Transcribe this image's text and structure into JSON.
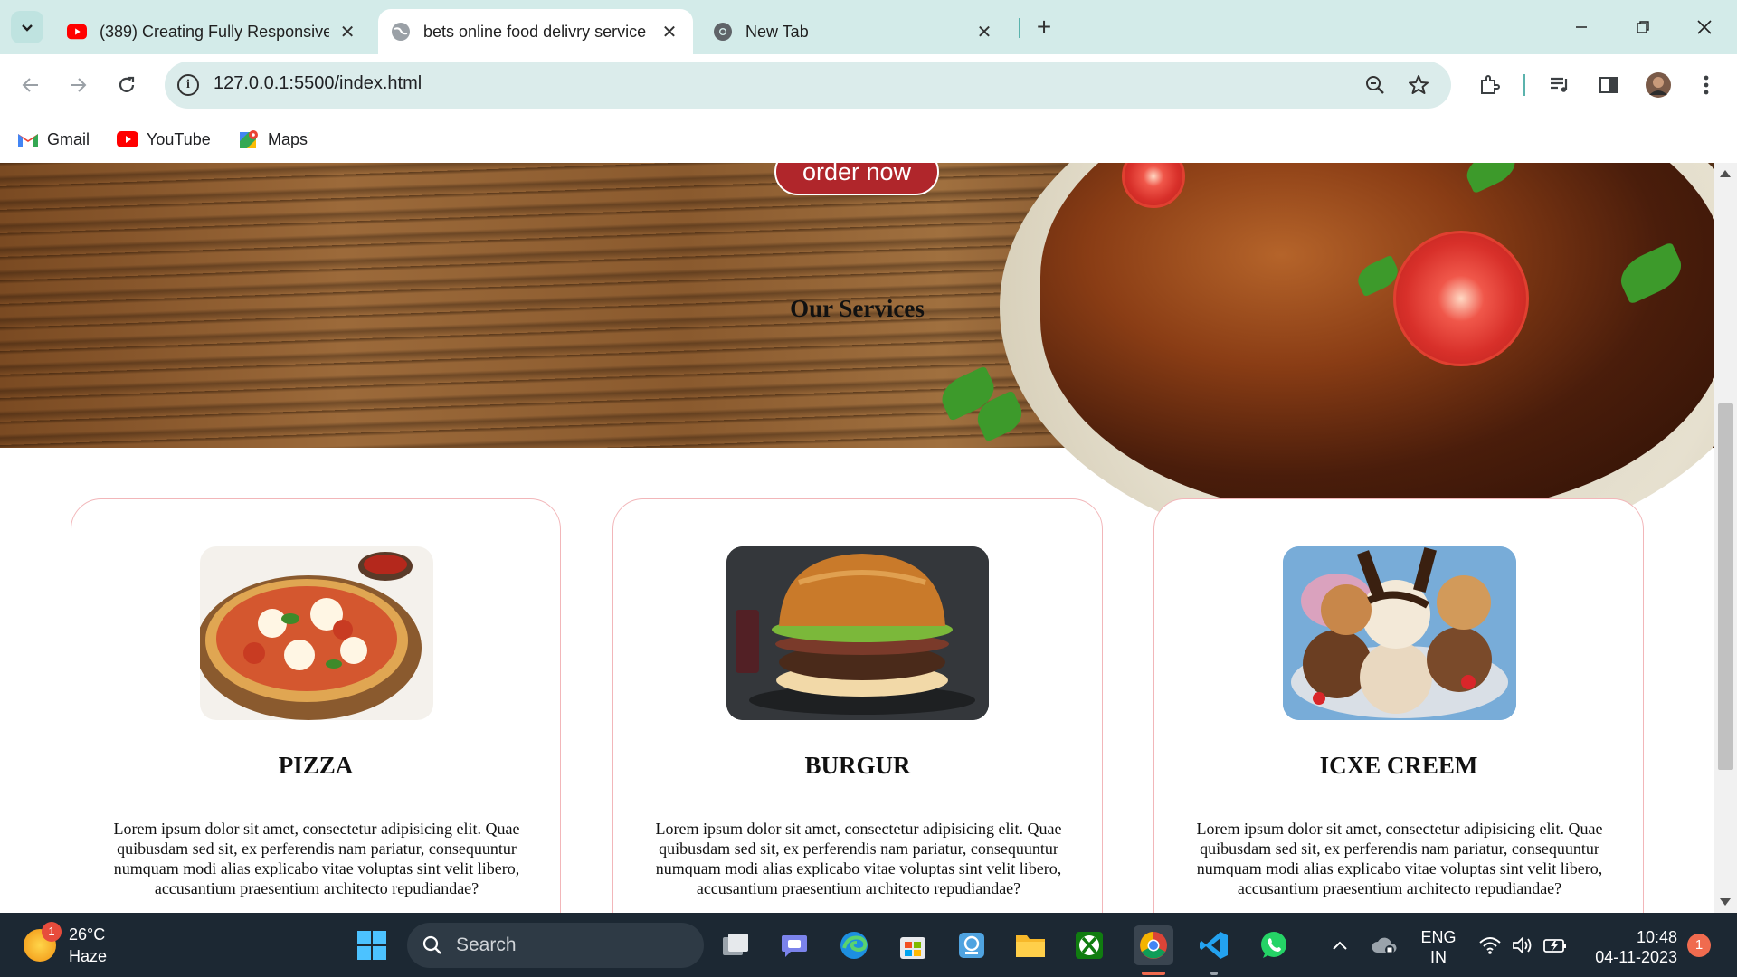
{
  "browser": {
    "tabs": [
      {
        "title": "(389) Creating Fully Responsive",
        "favicon": "youtube-icon",
        "active": false
      },
      {
        "title": "bets online food delivry service",
        "favicon": "globe-icon",
        "active": true
      },
      {
        "title": "New Tab",
        "favicon": "chrome-icon",
        "active": false
      }
    ],
    "address": "127.0.0.1:5500/index.html",
    "bookmarks": [
      {
        "label": "Gmail",
        "icon": "gmail-icon"
      },
      {
        "label": "YouTube",
        "icon": "youtube-icon"
      },
      {
        "label": "Maps",
        "icon": "maps-icon"
      }
    ]
  },
  "page": {
    "order_button": "order now",
    "services_heading": "Our Services",
    "cards": [
      {
        "title": "PIZZA",
        "image": "pizza-image",
        "description": "Lorem ipsum dolor sit amet, consectetur adipisicing elit. Quae quibusdam sed sit, ex perferendis nam pariatur, consequuntur numquam modi alias explicabo vitae voluptas sint velit libero, accusantium praesentium architecto repudiandae?"
      },
      {
        "title": "BURGUR",
        "image": "burger-image",
        "description": "Lorem ipsum dolor sit amet, consectetur adipisicing elit. Quae quibusdam sed sit, ex perferendis nam pariatur, consequuntur numquam modi alias explicabo vitae voluptas sint velit libero, accusantium praesentium architecto repudiandae?"
      },
      {
        "title": "ICXE CREEM",
        "image": "ice-cream-image",
        "description": "Lorem ipsum dolor sit amet, consectetur adipisicing elit. Quae quibusdam sed sit, ex perferendis nam pariatur, consequuntur numquam modi alias explicabo vitae voluptas sint velit libero, accusantium praesentium architecto repudiandae?"
      }
    ],
    "colors": {
      "accent": "#b0262b",
      "card_border": "#f2b6b9"
    }
  },
  "taskbar": {
    "weather": {
      "temp": "26°C",
      "condition": "Haze",
      "badge": "1"
    },
    "search_placeholder": "Search",
    "language": {
      "line1": "ENG",
      "line2": "IN"
    },
    "clock": {
      "time": "10:48",
      "date": "04-11-2023"
    },
    "notification_count": "1"
  }
}
